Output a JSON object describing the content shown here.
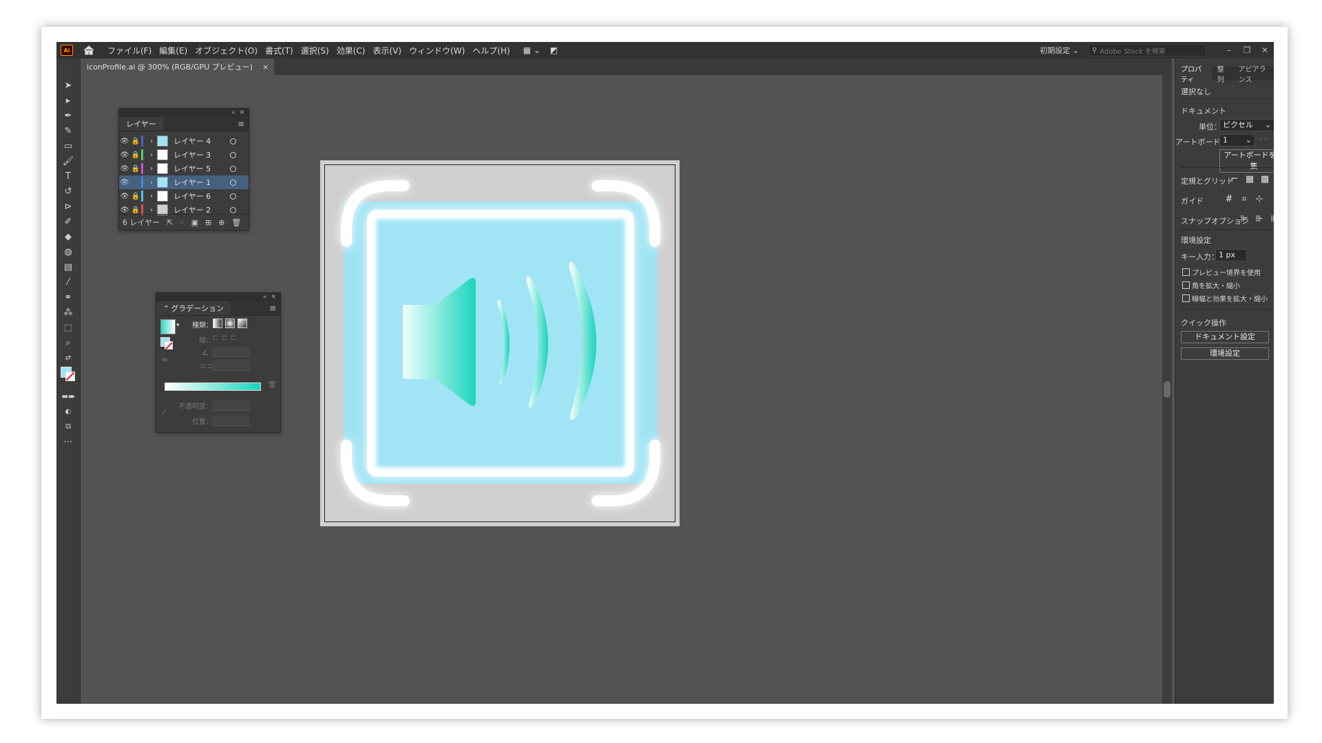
{
  "app": {
    "logo": "Ai",
    "menu": [
      "ファイル(F)",
      "編集(E)",
      "オブジェクト(O)",
      "書式(T)",
      "選択(S)",
      "効果(C)",
      "表示(V)",
      "ウィンドウ(W)",
      "ヘルプ(H)"
    ],
    "workspace": "初期設定",
    "stock_placeholder": "Adobe Stock を検索"
  },
  "document_tab": {
    "title": "iconProfile.ai @ 300% (RGB/GPU プレビュー)",
    "close": "×"
  },
  "layers_panel": {
    "title": "レイヤー",
    "layers": [
      {
        "name": "レイヤー 4",
        "color": "#4b61c8",
        "selected": false
      },
      {
        "name": "レイヤー 3",
        "color": "#4bd36a",
        "selected": false
      },
      {
        "name": "レイヤー 5",
        "color": "#c94fd6",
        "selected": false
      },
      {
        "name": "レイヤー 1",
        "color": "#4f7fe0",
        "selected": true
      },
      {
        "name": "レイヤー 6",
        "color": "#49c6e8",
        "selected": false
      },
      {
        "name": "レイヤー 2",
        "color": "#e24a4a",
        "selected": false
      }
    ],
    "count": "6 レイヤー"
  },
  "gradient_panel": {
    "title": "グラデーション",
    "type_label": "種類：",
    "stroke_label": "線：",
    "opacity_label": "不透明度：",
    "position_label": "位置："
  },
  "right_panel": {
    "tabs": [
      "プロパティ",
      "整列",
      "アピアランス"
    ],
    "no_selection": "選択なし",
    "document": "ドキュメント",
    "units_label": "単位：",
    "units_value": "ピクセル",
    "artboard_label": "アートボード：",
    "artboard_value": "1",
    "edit_artboard": "アートボードを編集",
    "rulers_grid": "定規とグリッド",
    "guides": "ガイド",
    "snap_options": "スナップオプション",
    "preferences": "環境設定",
    "key_input_label": "キー入力：",
    "key_input_value": "1 px",
    "opt_preview": "プレビュー境界を使用",
    "opt_corners": "角を拡大・縮小",
    "opt_strokes": "線幅と効果を拡大・縮小",
    "quick_actions": "クイック操作",
    "doc_settings": "ドキュメント設定",
    "prefs_button": "環境設定"
  },
  "colors": {
    "icon_fill": "#a0e4f5",
    "accent_teal": "#1bd4bd",
    "glow": "#ffffff"
  }
}
